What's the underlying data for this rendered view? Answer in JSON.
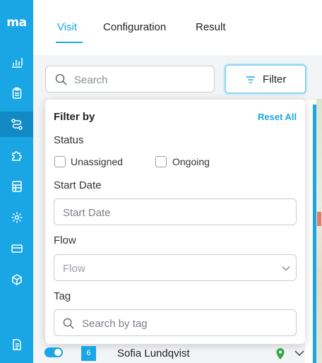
{
  "app": {
    "logo": "ma",
    "nav": [
      {
        "name": "analytics",
        "icon": "bar-chart-icon"
      },
      {
        "name": "clipboard",
        "icon": "clipboard-icon"
      },
      {
        "name": "flows",
        "icon": "route-icon"
      },
      {
        "name": "plugins",
        "icon": "puzzle-icon"
      },
      {
        "name": "sheets",
        "icon": "sheet-icon"
      },
      {
        "name": "settings",
        "icon": "gear-icon"
      },
      {
        "name": "billing",
        "icon": "card-icon"
      },
      {
        "name": "packages",
        "icon": "box-icon"
      },
      {
        "name": "docs",
        "icon": "document-icon"
      }
    ],
    "active_nav": "flows",
    "accent_color": "#1aa6e4"
  },
  "header": {
    "tabs": [
      {
        "label": "Visit",
        "active": true
      },
      {
        "label": "Configuration",
        "active": false
      },
      {
        "label": "Result",
        "active": false
      }
    ]
  },
  "toolbar": {
    "search_placeholder": "Search",
    "filter_label": "Filter"
  },
  "filter_panel": {
    "title": "Filter by",
    "reset_label": "Reset All",
    "status_label": "Status",
    "status_options": [
      {
        "label": "Unassigned",
        "checked": false
      },
      {
        "label": "Ongoing",
        "checked": false
      }
    ],
    "start_date_label": "Start Date",
    "start_date_placeholder": "Start Date",
    "flow_label": "Flow",
    "flow_placeholder": "Flow",
    "tag_label": "Tag",
    "tag_placeholder": "Search by tag"
  },
  "visible_row": {
    "enabled": true,
    "number": "6",
    "name": "Sofia Lundqvist"
  }
}
